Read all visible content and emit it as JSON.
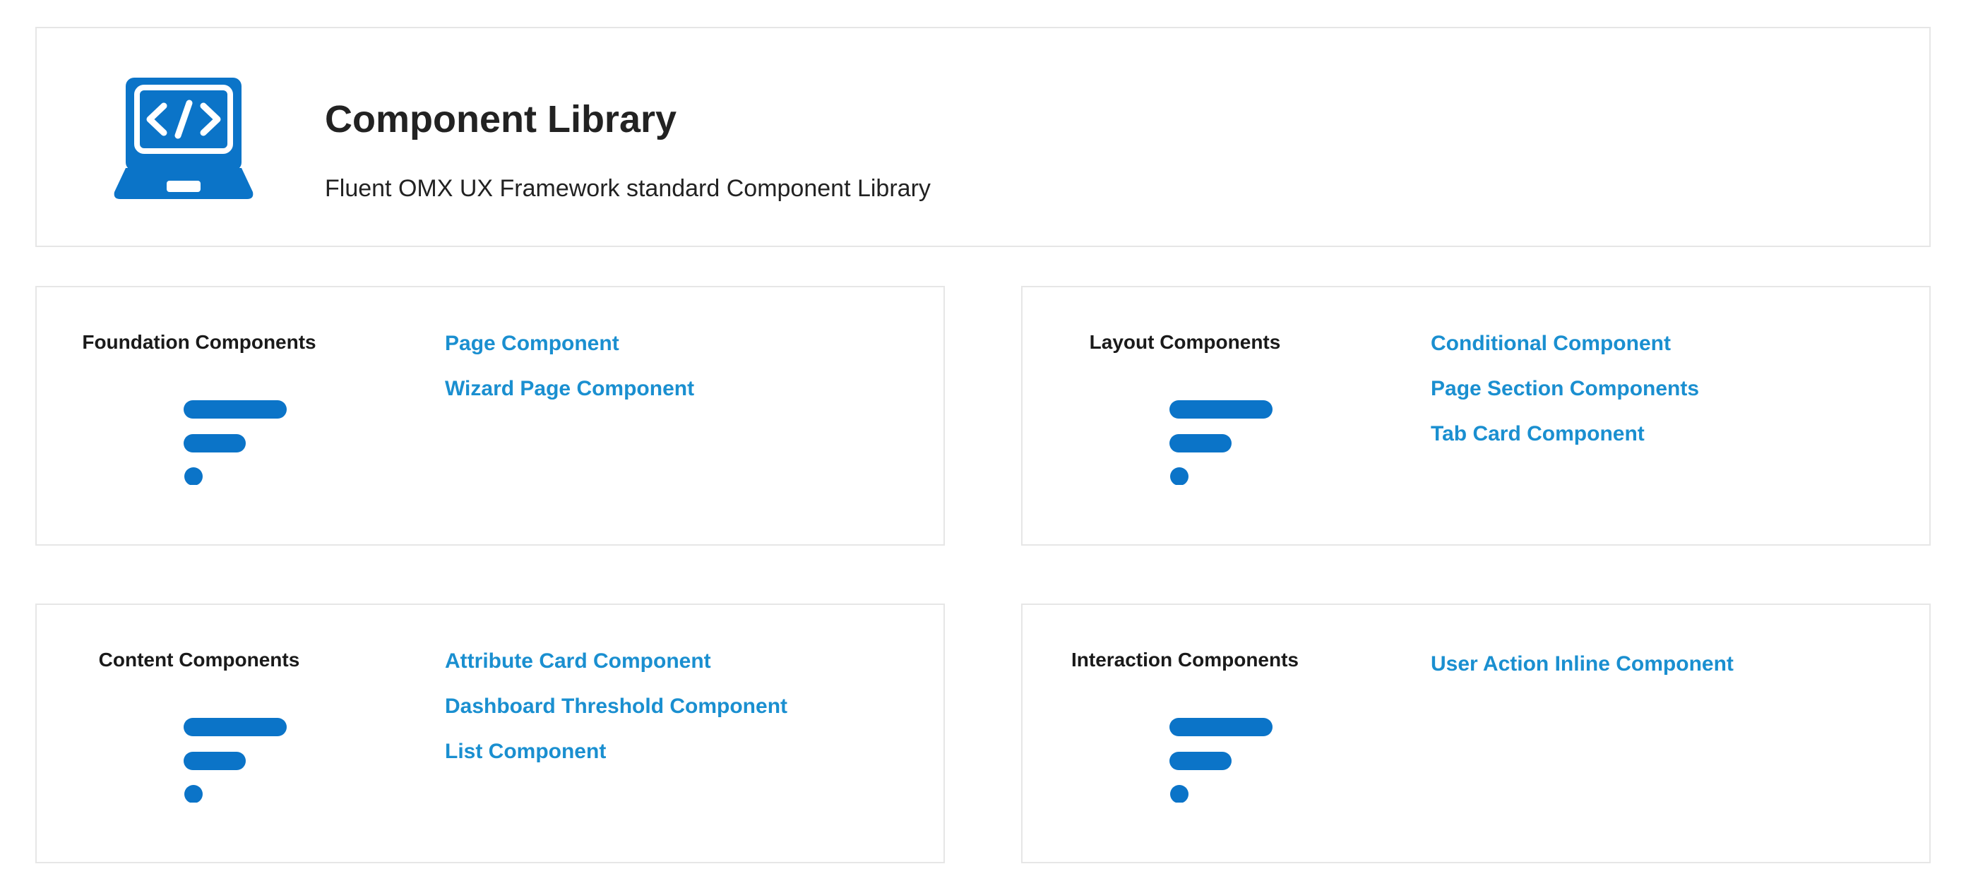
{
  "colors": {
    "accent": "#0b74c8",
    "link": "#1a8fd0",
    "border": "#e6e6e6",
    "text": "#222222"
  },
  "header": {
    "icon": "laptop-code-icon",
    "title": "Component Library",
    "subtitle": "Fluent OMX UX Framework standard Component Library"
  },
  "cards": [
    {
      "title": "Foundation Components",
      "icon": "fluent-logo-icon",
      "links": [
        "Page Component",
        "Wizard Page Component"
      ]
    },
    {
      "title": "Layout Components",
      "icon": "fluent-logo-icon",
      "links": [
        "Conditional Component",
        "Page Section Components",
        "Tab Card Component"
      ]
    },
    {
      "title": "Content Components",
      "icon": "fluent-logo-icon",
      "links": [
        "Attribute Card Component",
        "Dashboard Threshold Component",
        "List Component"
      ]
    },
    {
      "title": "Interaction Components",
      "icon": "fluent-logo-icon",
      "links": [
        "User Action Inline Component"
      ]
    }
  ]
}
